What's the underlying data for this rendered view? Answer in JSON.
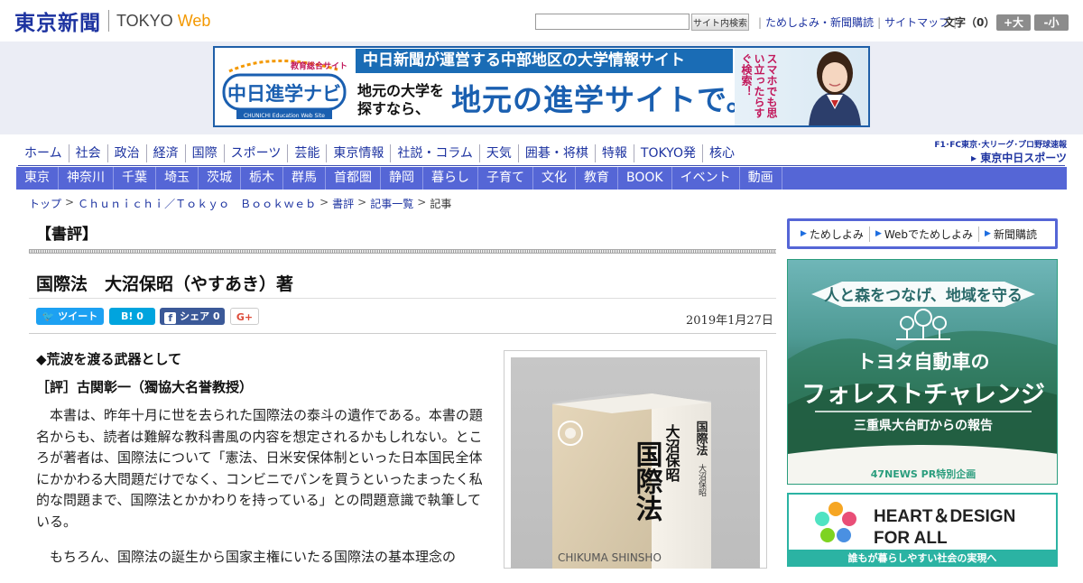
{
  "header": {
    "logo_jp": "東京新聞",
    "logo_tokyo": "TOKYO",
    "logo_web": "Web",
    "search_button": "サイト内検索",
    "links": [
      "ためしよみ・新聞購読",
      "サイトマップ"
    ],
    "fontsize_label": "文字（0）",
    "fontsize_large": "+大",
    "fontsize_small": "-小"
  },
  "banner": {
    "logo_caption": "教育総合サイト",
    "logo_main": "中日進学ナビ",
    "logo_sub": "CHUNICHI Education Web Site",
    "top_text": "中日新聞が運営する中部地区の大学情報サイト",
    "small_text_1": "地元の大学を",
    "small_text_2": "探すなら、",
    "big_text": "地元の進学サイトで。",
    "vertical_text": "スマホでも思い立ったらすぐ検索！"
  },
  "nav_primary": [
    "ホーム",
    "社会",
    "政治",
    "経済",
    "国際",
    "スポーツ",
    "芸能",
    "東京情報",
    "社説・コラム",
    "天気",
    "囲碁・将棋",
    "特報",
    "TOKYO発",
    "核心"
  ],
  "nav_secondary": [
    "東京",
    "神奈川",
    "千葉",
    "埼玉",
    "茨城",
    "栃木",
    "群馬",
    "首都圏",
    "静岡",
    "暮らし",
    "子育て",
    "文化",
    "教育",
    "BOOK",
    "イベント",
    "動画"
  ],
  "sports_logo": {
    "sub": "F1･FC東京･大リーグ･プロ野球速報",
    "main": "東京中日スポーツ"
  },
  "breadcrumb": [
    "トップ",
    "Ｃｈｕｎｉｃｈｉ／Ｔｏｋｙｏ　Ｂｏｏｋｗｅｂ",
    "書評",
    "記事一覧",
    "記事"
  ],
  "article": {
    "section": "【書評】",
    "title": "国際法　大沼保昭（やすあき）著",
    "share": {
      "tweet": "ツイート",
      "hatena": "B! 0",
      "facebook": "シェア 0",
      "gplus": "G+"
    },
    "date": "2019年1月27日",
    "heading": "◆荒波を渡る武器として",
    "reviewer": "［評］古関彰一（獨協大名誉教授）",
    "paragraphs": [
      "本書は、昨年十月に世を去られた国際法の泰斗の遺作である。本書の題名からも、読者は難解な教科書風の内容を想定されるかもしれない。ところが著者は、国際法について「憲法、日米安保体制といった日本国民全体にかかわる大問題だけでなく、コンビニでパンを買うといったまったく私的な問題まで、国際法とかかわりを持っている」との問題意識で執筆している。",
      "もちろん、国際法の誕生から国家主権にいたる国際法の基本理念の"
    ],
    "book": {
      "title": "国際法",
      "author": "大沼保昭",
      "publisher": "CHIKUMA SHINSHO"
    }
  },
  "sidebar": {
    "links": [
      "ためしよみ",
      "Webでためしよみ",
      "新聞購読"
    ],
    "ad_forest": {
      "ribbon": "人と森をつなげ、地域を守る",
      "line1": "トヨタ自動車の",
      "line2": "フォレストチャレンジ",
      "line3": "三重県大台町からの報告",
      "footer": "47NEWS PR特別企画"
    },
    "ad_heart": {
      "line1": "HEART＆DESIGN",
      "line2": "FOR ALL",
      "footer": "誰もが暮らしやすい社会の実現へ"
    }
  },
  "colors": {
    "brand_blue": "#1d33a0",
    "nav_bar": "#5566d6",
    "banner_bg": "#ebedf5",
    "twitter": "#1da1f2",
    "hatena": "#00a4de",
    "facebook": "#3b5998"
  }
}
